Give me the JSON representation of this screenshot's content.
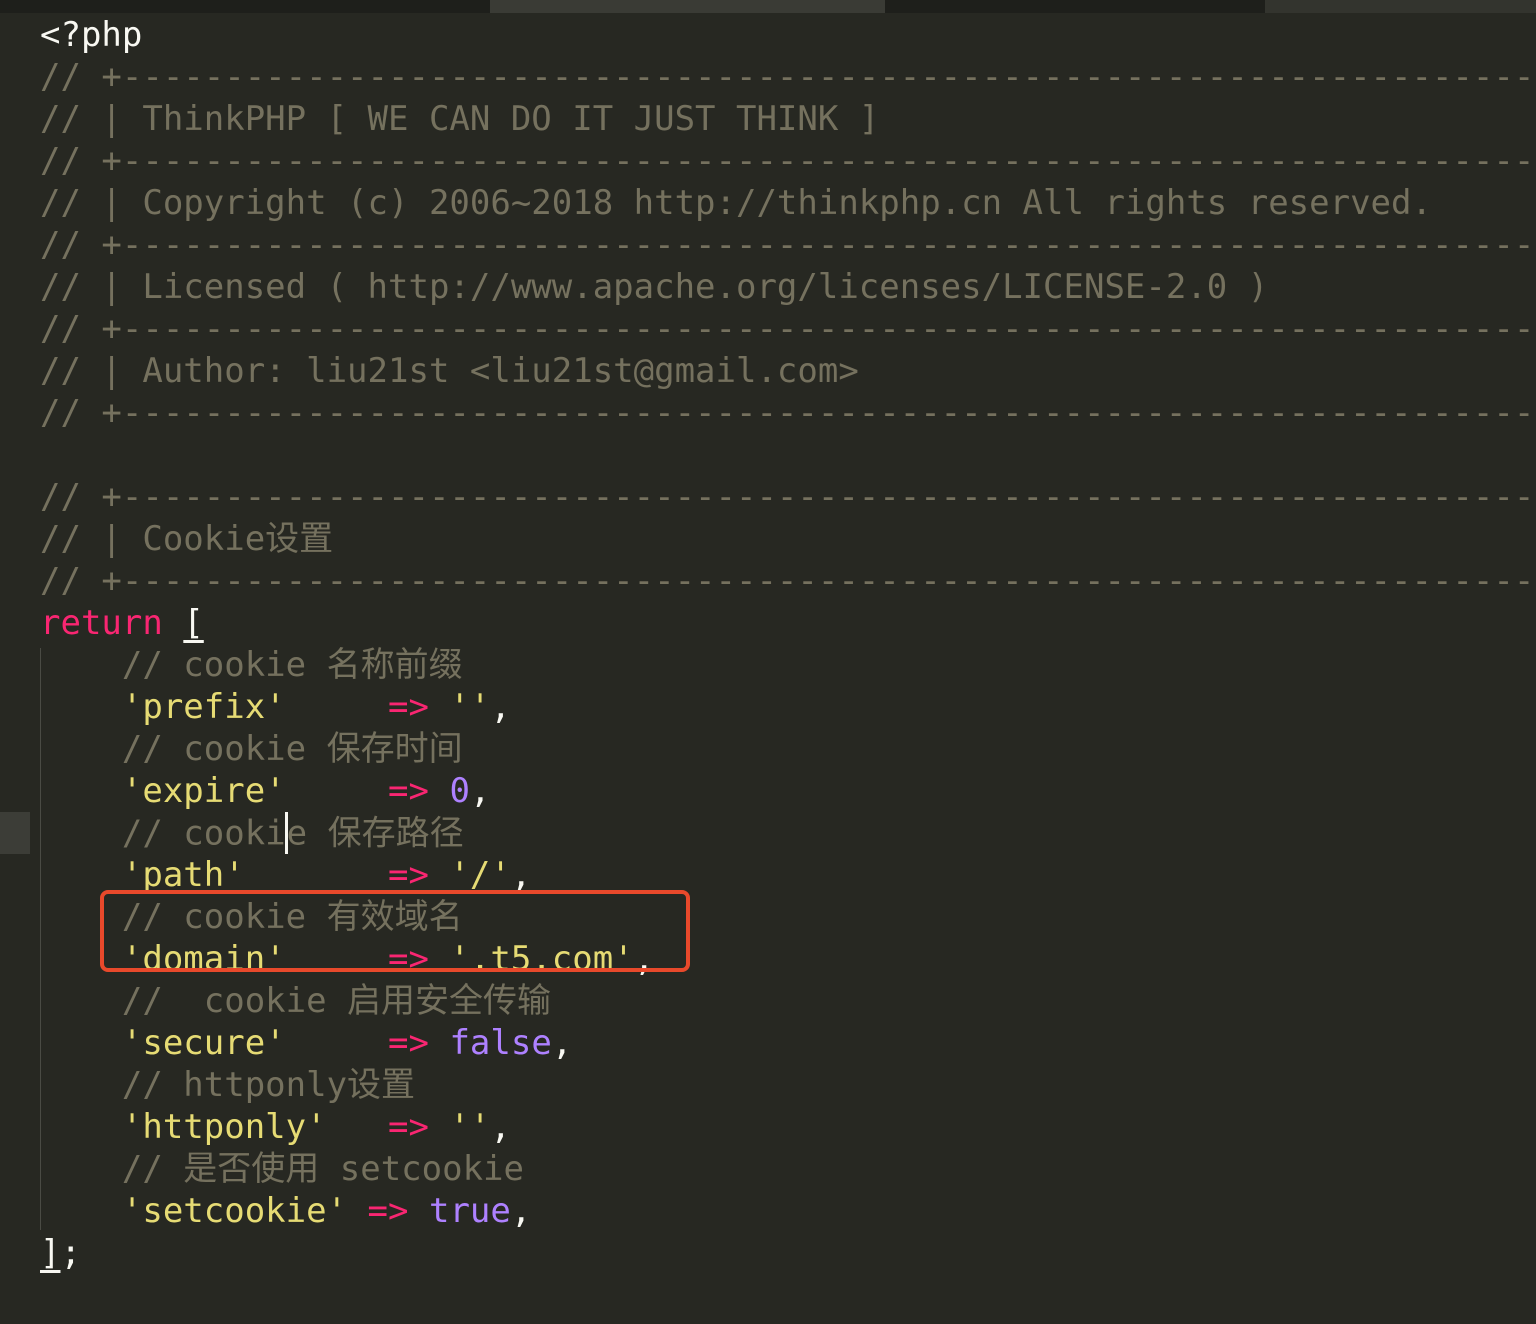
{
  "colors": {
    "background": "#272822",
    "comment": "#75715e",
    "keyword": "#f92672",
    "string": "#e6db74",
    "number": "#ae81ff",
    "plain": "#f8f8f2",
    "annotation_box": "#e8492b"
  },
  "code": {
    "open_tag": "<?php",
    "header": {
      "comment_prefix": "// ",
      "divider": "+--------------------------------------------------------------------------",
      "line1": "| ThinkPHP [ WE CAN DO IT JUST THINK ]",
      "line2": "| Copyright (c) 2006~2018 http://thinkphp.cn All rights reserved.",
      "line3": "| Licensed ( http://www.apache.org/licenses/LICENSE-2.0 )",
      "line4": "| Author: liu21st <liu21st@gmail.com>"
    },
    "section": {
      "title": "| Cookie设置"
    },
    "return_kw": "return",
    "open_bracket": "[",
    "close_bracket": "]",
    "semicolon": ";",
    "arrow": "=>",
    "comma": ",",
    "entries": [
      {
        "comment": "// cookie 名称前缀",
        "key": "'prefix'",
        "pad": "     ",
        "value": "''",
        "vtype": "str"
      },
      {
        "comment": "// cookie 保存时间",
        "key": "'expire'",
        "pad": "     ",
        "value": "0",
        "vtype": "num"
      },
      {
        "comment_a": "// cooki",
        "comment_b": "e 保存路径",
        "key": "'path'",
        "pad": "       ",
        "value": "'/'",
        "vtype": "str"
      },
      {
        "comment": "// cookie 有效域名",
        "key": "'domain'",
        "pad": "     ",
        "value": "'.t5.com'",
        "vtype": "str"
      },
      {
        "comment": "//  cookie 启用安全传输",
        "key": "'secure'",
        "pad": "     ",
        "value": "false",
        "vtype": "num"
      },
      {
        "comment": "// httponly设置",
        "key": "'httponly'",
        "pad": "   ",
        "value": "''",
        "vtype": "str"
      },
      {
        "comment": "// 是否使用 setcookie",
        "key": "'setcookie'",
        "pad": " ",
        "value": "true",
        "vtype": "num"
      }
    ]
  }
}
